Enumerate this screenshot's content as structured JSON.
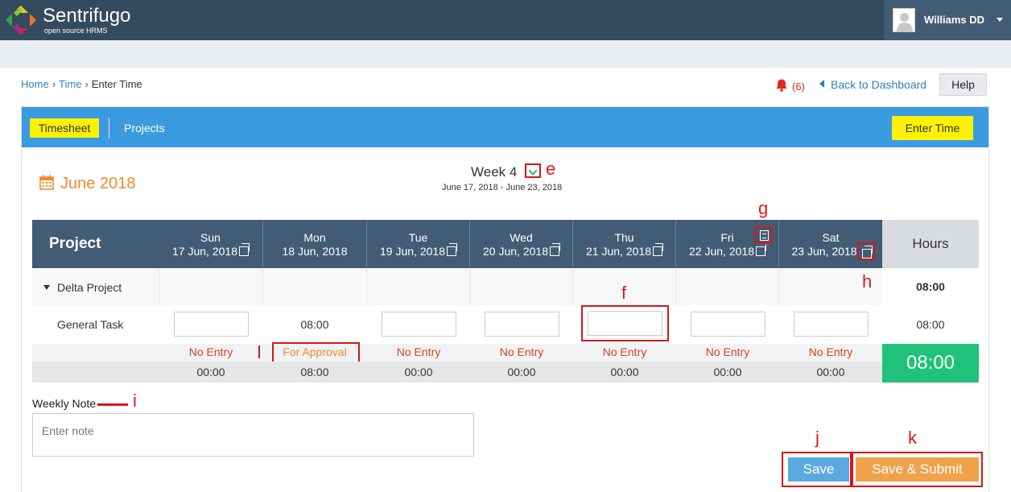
{
  "brand": {
    "name": "Sentrifugo",
    "tagline": "open source HRMS"
  },
  "user": {
    "name": "Williams DD"
  },
  "breadcrumb": {
    "home": "Home",
    "time": "Time",
    "current": "Enter Time"
  },
  "notifications": {
    "count": "(6)"
  },
  "nav": {
    "back_to_dashboard": "Back to Dashboard",
    "help": "Help"
  },
  "tabs": {
    "timesheet": "Timesheet",
    "projects": "Projects",
    "enter_time": "Enter Time"
  },
  "calendar": {
    "month": "June 2018",
    "week": "Week 4",
    "range": "June 17, 2018 - June 23, 2018"
  },
  "table": {
    "project_header": "Project",
    "hours_header": "Hours",
    "days": [
      {
        "day": "Sun",
        "date": "17 Jun, 2018",
        "status": "No Entry",
        "total": "00:00"
      },
      {
        "day": "Mon",
        "date": "18 Jun, 2018",
        "status": "For Approval",
        "total": "08:00",
        "value": "08:00"
      },
      {
        "day": "Tue",
        "date": "19 Jun, 2018",
        "status": "No Entry",
        "total": "00:00"
      },
      {
        "day": "Wed",
        "date": "20 Jun, 2018",
        "status": "No Entry",
        "total": "00:00"
      },
      {
        "day": "Thu",
        "date": "21 Jun, 2018",
        "status": "No Entry",
        "total": "00:00"
      },
      {
        "day": "Fri",
        "date": "22 Jun, 2018",
        "status": "No Entry",
        "total": "00:00"
      },
      {
        "day": "Sat",
        "date": "23 Jun, 2018",
        "status": "No Entry",
        "total": "00:00"
      }
    ],
    "project_name": "Delta Project",
    "project_hours": "08:00",
    "task_name": "General Task",
    "task_hours": "08:00",
    "grand_total": "08:00"
  },
  "note": {
    "label": "Weekly Note",
    "placeholder": "Enter note"
  },
  "actions": {
    "save": "Save",
    "save_submit": "Save & Submit"
  },
  "annotations": {
    "e": "e",
    "f": "f",
    "g": "g",
    "h": "h",
    "i": "i",
    "j": "j",
    "k": "k",
    "l": "l"
  },
  "colors": {
    "topbar": "#344a5f",
    "tabbar": "#3a9be0",
    "highlight": "#fdf205",
    "accent": "#ef8a2e",
    "total": "#20c279",
    "annotation": "#d6161a"
  }
}
